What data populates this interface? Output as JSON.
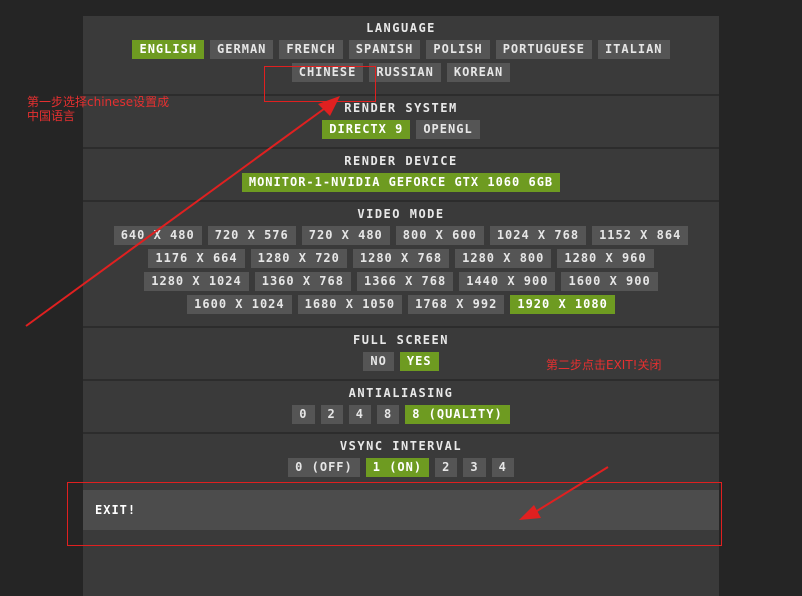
{
  "sections": {
    "language": {
      "title": "LANGUAGE",
      "options": [
        "ENGLISH",
        "GERMAN",
        "FRENCH",
        "SPANISH",
        "POLISH",
        "PORTUGUESE",
        "ITALIAN",
        "CHINESE",
        "RUSSIAN",
        "KOREAN"
      ],
      "selected": "ENGLISH"
    },
    "render_system": {
      "title": "RENDER SYSTEM",
      "options": [
        "DIRECTX 9",
        "OPENGL"
      ],
      "selected": "DIRECTX 9"
    },
    "render_device": {
      "title": "RENDER DEVICE",
      "options": [
        "MONITOR-1-NVIDIA GEFORCE GTX 1060 6GB"
      ],
      "selected": "MONITOR-1-NVIDIA GEFORCE GTX 1060 6GB"
    },
    "video_mode": {
      "title": "VIDEO MODE",
      "options": [
        "640 X 480",
        "720 X 576",
        "720 X 480",
        "800 X 600",
        "1024 X 768",
        "1152 X 864",
        "1176 X 664",
        "1280 X 720",
        "1280 X 768",
        "1280 X 800",
        "1280 X 960",
        "1280 X 1024",
        "1360 X 768",
        "1366 X 768",
        "1440 X 900",
        "1600 X 900",
        "1600 X 1024",
        "1680 X 1050",
        "1768 X 992",
        "1920 X 1080"
      ],
      "selected": "1920 X 1080"
    },
    "full_screen": {
      "title": "FULL SCREEN",
      "options": [
        "NO",
        "YES"
      ],
      "selected": "YES"
    },
    "antialiasing": {
      "title": "ANTIALIASING",
      "options": [
        "0",
        "2",
        "4",
        "8",
        "8 (QUALITY)"
      ],
      "selected": "8 (QUALITY)"
    },
    "vsync_interval": {
      "title": "VSYNC INTERVAL",
      "options": [
        "0 (OFF)",
        "1 (ON)",
        "2",
        "3",
        "4"
      ],
      "selected": "1 (ON)"
    }
  },
  "exit": {
    "label": "EXIT!"
  },
  "annotations": {
    "step1": "第一步选择chinese设置成\n中国语言",
    "step2": "第二步点击EXIT!关闭",
    "color": "#e02020"
  },
  "colors": {
    "selected": "#6e9b21",
    "option": "#555555",
    "panel": "#3a3a3a"
  }
}
